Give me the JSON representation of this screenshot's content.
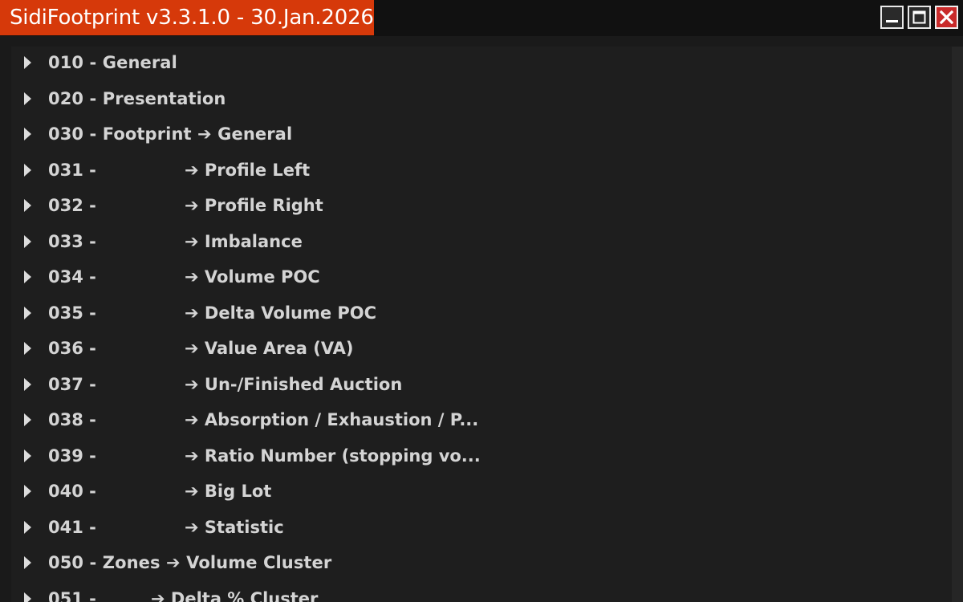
{
  "window": {
    "title": "SidiFootprint v3.3.1.0 - 30.Jan.2026",
    "title_color": "#d6390a",
    "buttons": [
      "minimize",
      "maximize",
      "close"
    ]
  },
  "tree": {
    "rows": [
      {
        "label": "010 - General"
      },
      {
        "label": "020 - Presentation"
      },
      {
        "label": "030 - Footprint ➔ General"
      },
      {
        "num": "031 -",
        "sub": "➔ Profile Left"
      },
      {
        "num": "032 -",
        "sub": "➔ Profile Right"
      },
      {
        "num": "033 -",
        "sub": "➔ Imbalance"
      },
      {
        "num": "034 -",
        "sub": "➔ Volume POC"
      },
      {
        "num": "035 -",
        "sub": "➔ Delta Volume POC"
      },
      {
        "num": "036 -",
        "sub": "➔ Value Area (VA)"
      },
      {
        "num": "037 -",
        "sub": "➔ Un-/Finished Auction"
      },
      {
        "num": "038 -",
        "sub": "➔ Absorption / Exhaustion / P..."
      },
      {
        "num": "039 -",
        "sub": "➔ Ratio Number (stopping vo..."
      },
      {
        "num": "040 -",
        "sub": "➔ Big Lot"
      },
      {
        "num": "041 -",
        "sub": "➔ Statistic"
      },
      {
        "label": "050 - Zones ➔ Volume Cluster"
      },
      {
        "num": "051 -",
        "sub": "➔ Delta % Cluster"
      }
    ]
  }
}
